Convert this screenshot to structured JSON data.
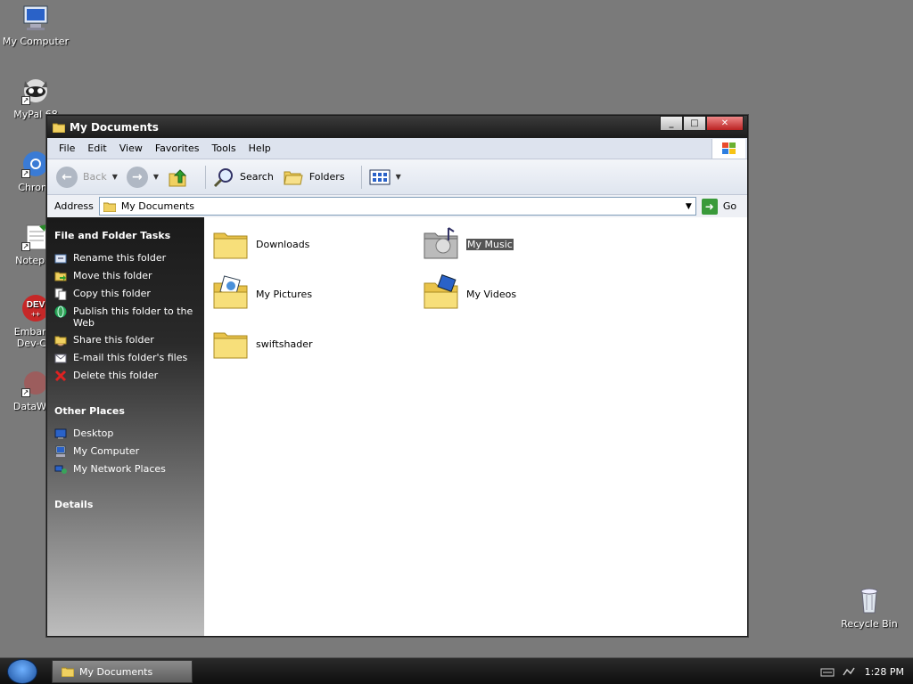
{
  "desktop": {
    "icons": [
      {
        "label": "My Computer",
        "icon": "my-computer-icon"
      },
      {
        "label": "MyPal 68",
        "icon": "mypal-icon"
      },
      {
        "label": "Chromi",
        "icon": "chromium-icon"
      },
      {
        "label": "Notepac",
        "icon": "notepad-icon"
      },
      {
        "label": "Embarca",
        "label2": "Dev-C+",
        "icon": "devcpp-icon"
      },
      {
        "label": "DataWag",
        "icon": "datawag-icon"
      }
    ],
    "recycle_bin": {
      "label": "Recycle Bin",
      "icon": "recycle-bin-icon"
    },
    "dev_badge_text": "DEV"
  },
  "window": {
    "title": "My Documents",
    "controls": {
      "minimize": "_",
      "maximize": "□",
      "close": "✕"
    },
    "menu": [
      "File",
      "Edit",
      "View",
      "Favorites",
      "Tools",
      "Help"
    ],
    "toolbar": {
      "back": "Back",
      "search": "Search",
      "folders": "Folders"
    },
    "address": {
      "label": "Address",
      "value": "My Documents",
      "go": "Go"
    },
    "taskpane": {
      "file_tasks": {
        "heading": "File and Folder Tasks",
        "items": [
          "Rename this folder",
          "Move this folder",
          "Copy this folder",
          "Publish this folder to the Web",
          "Share this folder",
          "E-mail this folder's files",
          "Delete this folder"
        ]
      },
      "other_places": {
        "heading": "Other Places",
        "items": [
          "Desktop",
          "My Computer",
          "My Network Places"
        ]
      },
      "details": {
        "heading": "Details"
      }
    },
    "content": {
      "items": [
        {
          "label": "Downloads",
          "icon": "folder-icon"
        },
        {
          "label": "My Music",
          "icon": "music-folder-icon",
          "selected": true
        },
        {
          "label": "My Pictures",
          "icon": "pictures-folder-icon"
        },
        {
          "label": "My Videos",
          "icon": "videos-folder-icon"
        },
        {
          "label": "swiftshader",
          "icon": "folder-icon"
        }
      ]
    }
  },
  "taskbar": {
    "task_label": "My Documents",
    "clock": "1:28 PM"
  },
  "colors": {
    "desktop_bg": "#7a7a7a",
    "selection": "#555555",
    "taskbar": "#1b1b1b"
  }
}
